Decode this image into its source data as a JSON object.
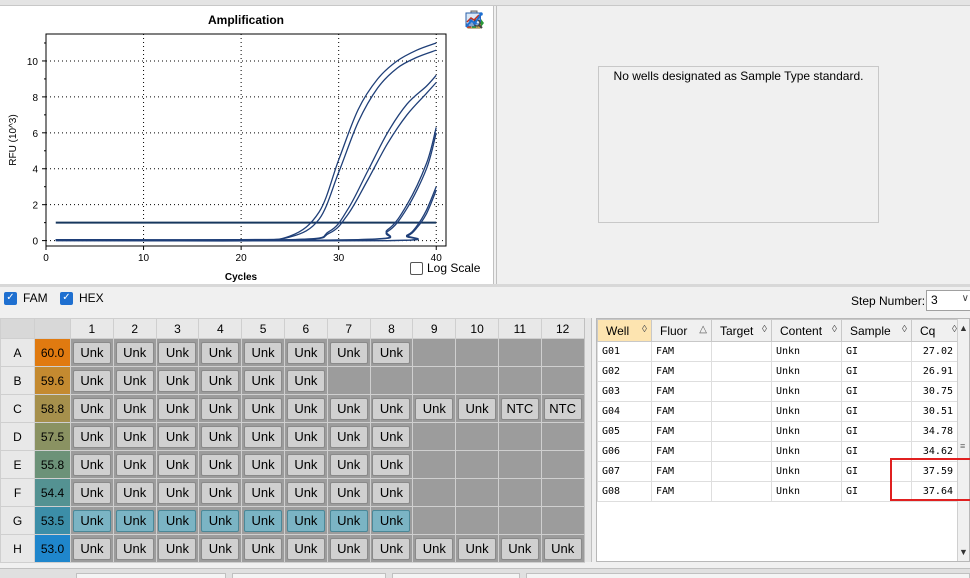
{
  "chart_data": {
    "type": "line",
    "title": "Amplification",
    "xlabel": "Cycles",
    "ylabel": "RFU (10^3)",
    "xlim": [
      0,
      41
    ],
    "ylim": [
      -0.3,
      11.5
    ],
    "xticks": [
      "0",
      "10",
      "20",
      "30",
      "40"
    ],
    "yticks": [
      "0",
      "2",
      "4",
      "6",
      "8",
      "10"
    ],
    "grid": true,
    "threshold": 1.0,
    "series": [
      {
        "values": [
          [
            1,
            0.05
          ],
          [
            20,
            0.05
          ],
          [
            25,
            0.25
          ],
          [
            28,
            1.6
          ],
          [
            30,
            4.5
          ],
          [
            32,
            7.3
          ],
          [
            34,
            9.0
          ],
          [
            36,
            10.0
          ],
          [
            38,
            10.6
          ],
          [
            40,
            11.0
          ]
        ]
      },
      {
        "values": [
          [
            1,
            0.05
          ],
          [
            20,
            0.05
          ],
          [
            25,
            0.2
          ],
          [
            28,
            1.2
          ],
          [
            30,
            3.8
          ],
          [
            32,
            6.6
          ],
          [
            34,
            8.5
          ],
          [
            36,
            9.6
          ],
          [
            38,
            10.2
          ],
          [
            40,
            10.6
          ]
        ]
      },
      {
        "values": [
          [
            1,
            0.05
          ],
          [
            25,
            0.05
          ],
          [
            29,
            0.5
          ],
          [
            31,
            1.8
          ],
          [
            33,
            3.9
          ],
          [
            35,
            6.0
          ],
          [
            37,
            7.6
          ],
          [
            39,
            8.6
          ],
          [
            40,
            9.2
          ]
        ]
      },
      {
        "values": [
          [
            1,
            0.05
          ],
          [
            25,
            0.05
          ],
          [
            29,
            0.4
          ],
          [
            31,
            1.5
          ],
          [
            33,
            3.4
          ],
          [
            35,
            5.4
          ],
          [
            37,
            7.0
          ],
          [
            39,
            8.2
          ],
          [
            40,
            8.8
          ]
        ]
      },
      {
        "values": [
          [
            1,
            0.05
          ],
          [
            32,
            0.05
          ],
          [
            35,
            0.6
          ],
          [
            37,
            2.0
          ],
          [
            39,
            4.3
          ],
          [
            40,
            6.3
          ]
        ]
      },
      {
        "values": [
          [
            1,
            0.05
          ],
          [
            32,
            0.05
          ],
          [
            35,
            0.5
          ],
          [
            37,
            1.8
          ],
          [
            39,
            4.0
          ],
          [
            40,
            6.0
          ]
        ]
      },
      {
        "values": [
          [
            1,
            0.0
          ],
          [
            35,
            0.0
          ],
          [
            37,
            0.3
          ],
          [
            38,
            0.8
          ],
          [
            39,
            1.7
          ],
          [
            40,
            3.0
          ]
        ]
      },
      {
        "values": [
          [
            1,
            0.0
          ],
          [
            35,
            0.0
          ],
          [
            37,
            0.25
          ],
          [
            38,
            0.7
          ],
          [
            39,
            1.5
          ],
          [
            40,
            2.8
          ]
        ]
      }
    ]
  },
  "chart_toolbar": {
    "icons": [
      "clipboard-icon",
      "chart-settings-icon",
      "export-icon",
      "zoom-icon",
      "line-style-icon"
    ]
  },
  "log_scale": {
    "label": "Log Scale",
    "checked": false
  },
  "standard_curve": {
    "message": "No wells designated as Sample Type standard."
  },
  "fluorophores": [
    {
      "label": "FAM",
      "checked": true
    },
    {
      "label": "HEX",
      "checked": true
    }
  ],
  "step": {
    "label": "Step Number:",
    "value": "3"
  },
  "plate": {
    "columns": [
      "1",
      "2",
      "3",
      "4",
      "5",
      "6",
      "7",
      "8",
      "9",
      "10",
      "11",
      "12"
    ],
    "rows": [
      {
        "label": "A",
        "temp": "60.0",
        "color": "#e07a10",
        "wells": [
          "Unk",
          "Unk",
          "Unk",
          "Unk",
          "Unk",
          "Unk",
          "Unk",
          "Unk",
          "",
          "",
          "",
          ""
        ]
      },
      {
        "label": "B",
        "temp": "59.6",
        "color": "#c48a30",
        "wells": [
          "Unk",
          "Unk",
          "Unk",
          "Unk",
          "Unk",
          "Unk",
          "",
          "",
          "",
          "",
          "",
          ""
        ]
      },
      {
        "label": "C",
        "temp": "58.8",
        "color": "#a6904c",
        "wells": [
          "Unk",
          "Unk",
          "Unk",
          "Unk",
          "Unk",
          "Unk",
          "Unk",
          "Unk",
          "Unk",
          "Unk",
          "NTC",
          "NTC"
        ]
      },
      {
        "label": "D",
        "temp": "57.5",
        "color": "#8a9262",
        "wells": [
          "Unk",
          "Unk",
          "Unk",
          "Unk",
          "Unk",
          "Unk",
          "Unk",
          "Unk",
          "",
          "",
          "",
          ""
        ]
      },
      {
        "label": "E",
        "temp": "55.8",
        "color": "#6c9278",
        "wells": [
          "Unk",
          "Unk",
          "Unk",
          "Unk",
          "Unk",
          "Unk",
          "Unk",
          "Unk",
          "",
          "",
          "",
          ""
        ]
      },
      {
        "label": "F",
        "temp": "54.4",
        "color": "#549292",
        "wells": [
          "Unk",
          "Unk",
          "Unk",
          "Unk",
          "Unk",
          "Unk",
          "Unk",
          "Unk",
          "",
          "",
          "",
          ""
        ]
      },
      {
        "label": "G",
        "temp": "53.5",
        "color": "#3c8ea8",
        "selected": true,
        "wells": [
          "Unk",
          "Unk",
          "Unk",
          "Unk",
          "Unk",
          "Unk",
          "Unk",
          "Unk",
          "",
          "",
          "",
          ""
        ]
      },
      {
        "label": "H",
        "temp": "53.0",
        "color": "#1f86cc",
        "wells": [
          "Unk",
          "Unk",
          "Unk",
          "Unk",
          "Unk",
          "Unk",
          "Unk",
          "Unk",
          "Unk",
          "Unk",
          "Unk",
          "Unk"
        ]
      }
    ]
  },
  "grid": {
    "columns": [
      "Well",
      "Fluor",
      "Target",
      "Content",
      "Sample",
      "Cq"
    ],
    "rows": [
      [
        "G01",
        "FAM",
        "",
        "Unkn",
        "GI",
        "27.02"
      ],
      [
        "G02",
        "FAM",
        "",
        "Unkn",
        "GI",
        "26.91"
      ],
      [
        "G03",
        "FAM",
        "",
        "Unkn",
        "GI",
        "30.75"
      ],
      [
        "G04",
        "FAM",
        "",
        "Unkn",
        "GI",
        "30.51"
      ],
      [
        "G05",
        "FAM",
        "",
        "Unkn",
        "GI",
        "34.78"
      ],
      [
        "G06",
        "FAM",
        "",
        "Unkn",
        "GI",
        "34.62"
      ],
      [
        "G07",
        "FAM",
        "",
        "Unkn",
        "GI",
        "37.59"
      ],
      [
        "G08",
        "FAM",
        "",
        "Unkn",
        "GI",
        "37.64"
      ]
    ]
  },
  "colors": {
    "curve": "#1f3f78",
    "threshold": "#17375e",
    "highlight": "#e02020"
  }
}
